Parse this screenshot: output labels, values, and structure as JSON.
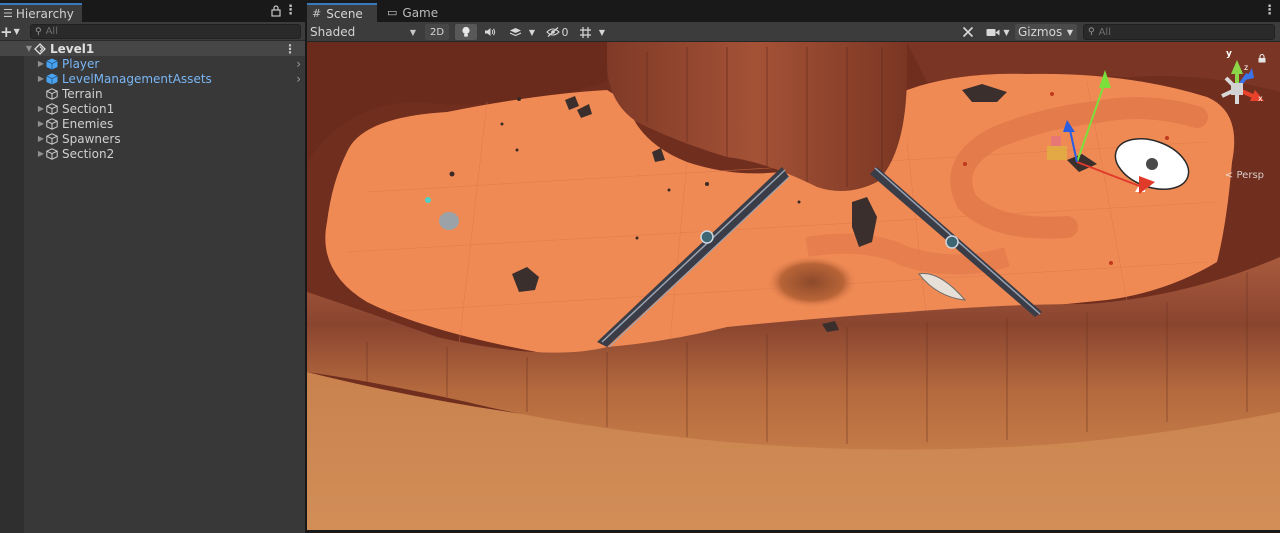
{
  "hierarchy": {
    "tab_label": "Hierarchy",
    "search_placeholder": "All",
    "root": "Level1",
    "items": [
      {
        "label": "Player",
        "style": "prefab",
        "has_arrow": true
      },
      {
        "label": "LevelManagementAssets",
        "style": "prefab",
        "has_arrow": true
      },
      {
        "label": "Terrain",
        "style": "normal",
        "has_arrow": false
      },
      {
        "label": "Section1",
        "style": "normal",
        "has_arrow": false
      },
      {
        "label": "Enemies",
        "style": "normal",
        "has_arrow": false
      },
      {
        "label": "Spawners",
        "style": "normal",
        "has_arrow": false
      },
      {
        "label": "Section2",
        "style": "normal",
        "has_arrow": false
      }
    ]
  },
  "scene": {
    "tabs": [
      {
        "label": "Scene",
        "icon": "grid-icon",
        "active": true
      },
      {
        "label": "Game",
        "icon": "gamepad-icon",
        "active": false
      }
    ],
    "toolbar": {
      "shading_mode": "Shaded",
      "mode_2d_label": "2D",
      "hidden_count": "0",
      "gizmos_label": "Gizmos",
      "search_placeholder": "All"
    },
    "orientation_gizmo": {
      "projection_label": "Persp",
      "axis_y": "y",
      "axis_z": "z",
      "axis_x": "x"
    }
  },
  "colors": {
    "accent_tab": "#3a79bb",
    "prefab_text": "#7ab6f5",
    "panel_bg": "#383838",
    "terrain_floor": "#f08a55"
  }
}
